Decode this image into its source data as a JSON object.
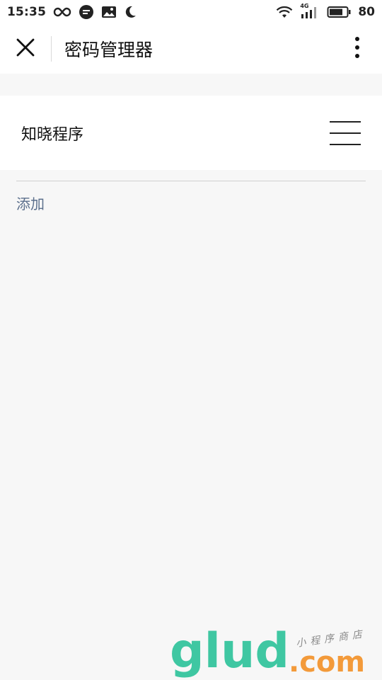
{
  "status_bar": {
    "time": "15:35",
    "network_label": "4G",
    "battery_level": "80",
    "icons": [
      "infinity-icon",
      "chat-bubble-icon",
      "image-icon",
      "moon-icon",
      "wifi-icon",
      "signal-icon",
      "battery-icon"
    ]
  },
  "navbar": {
    "title": "密码管理器",
    "close_icon": "close-icon",
    "more_icon": "more-vertical-icon"
  },
  "card": {
    "title": "知晓程序",
    "menu_icon": "hamburger-menu-icon"
  },
  "main": {
    "add_label": "添加"
  },
  "watermark": {
    "brand": "glud",
    "domain": ".com",
    "tagline": "小程序商店",
    "colors": {
      "brand": "#3fc7a2",
      "domain": "#f39a3a"
    }
  },
  "colors": {
    "background": "#f7f7f7",
    "surface": "#ffffff",
    "link": "#5b6f8c"
  }
}
